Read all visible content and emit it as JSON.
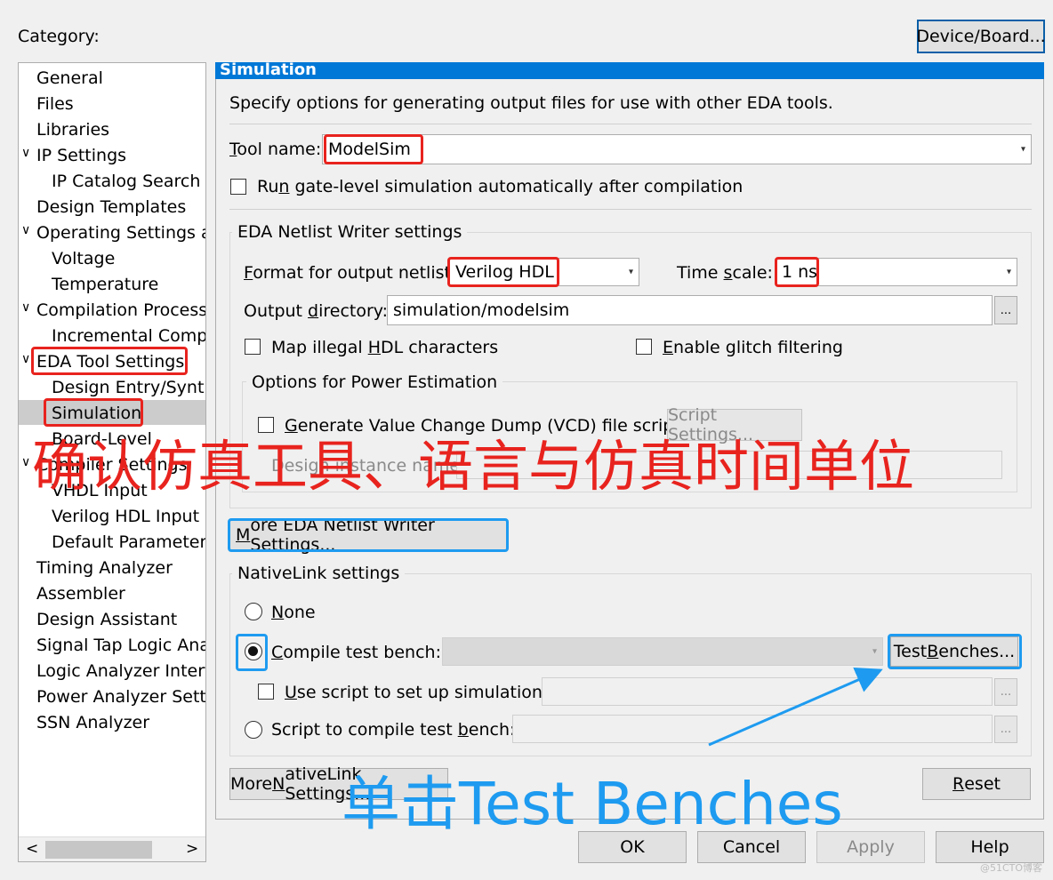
{
  "category_label": "Category:",
  "device_board_button": "Device/Board...",
  "tree": {
    "general": "General",
    "files": "Files",
    "libraries": "Libraries",
    "ip_settings": "IP Settings",
    "ip_catalog": "IP Catalog Search L",
    "design_templates": "Design Templates",
    "operating_settings": "Operating Settings ar",
    "voltage": "Voltage",
    "temperature": "Temperature",
    "compilation_process": "Compilation Process",
    "incremental": "Incremental Compil",
    "eda_tool_settings": "EDA Tool Settings",
    "design_entry": "Design Entry/Synth",
    "simulation": "Simulation",
    "board_level": "Board-Level",
    "compiler_settings": "Compiler Settings",
    "vhdl_input": "VHDL Input",
    "verilog_input": "Verilog HDL Input",
    "default_parameters": "Default Parameters",
    "timing_analyzer": "Timing Analyzer",
    "assembler": "Assembler",
    "design_assistant": "Design Assistant",
    "signal_tap": "Signal Tap Logic Anal",
    "logic_analyzer": "Logic Analyzer Interfa",
    "power_analyzer": "Power Analyzer Setti",
    "ssn_analyzer": "SSN Analyzer",
    "scroll_left": "<",
    "scroll_right": ">"
  },
  "panel": {
    "title": "Simulation",
    "description": "Specify options for generating output files for use with other EDA tools.",
    "tool_name_label_u": "T",
    "tool_name_label_rest": "ool name:",
    "tool_name_value": "ModelSim",
    "run_gate_label_a": "Ru",
    "run_gate_label_u": "n",
    "run_gate_label_b": " gate-level simulation automatically after compilation",
    "netlist_group": "EDA Netlist Writer settings",
    "format_label_u": "F",
    "format_label_rest": "ormat for output netlist:",
    "format_value": "Verilog HDL",
    "timescale_label_a": "Time ",
    "timescale_label_u": "s",
    "timescale_label_b": "cale:",
    "timescale_value": "1 ns",
    "outdir_label_a": "Output ",
    "outdir_label_u": "d",
    "outdir_label_b": "irectory:",
    "outdir_value": "simulation/modelsim",
    "browse": "...",
    "map_illegal_a": "Map illegal ",
    "map_illegal_u": "H",
    "map_illegal_b": "DL characters",
    "glitch_u": "E",
    "glitch_rest": "nable glitch filtering",
    "power_group": "Options for Power Estimation",
    "vcd_u": "G",
    "vcd_rest": "enerate Value Change Dump (VCD) file script",
    "script_settings": "Script Settings...",
    "design_instance_label": "Design instance name:",
    "more_eda_u": "M",
    "more_eda_rest": "ore EDA Netlist Writer Settings...",
    "nativelink_group": "NativeLink settings",
    "none_a": "N",
    "none_b": "one",
    "compile_tb_u": "C",
    "compile_tb_rest": "ompile test bench:",
    "test_benches_a": "Test ",
    "test_benches_u": "B",
    "test_benches_b": "enches...",
    "use_script_u": "U",
    "use_script_rest": "se script to set up simulation:",
    "script_compile_a": "Script to compile test ",
    "script_compile_u": "b",
    "script_compile_b": "ench:",
    "more_nativelink_a": "More ",
    "more_nativelink_u": "N",
    "more_nativelink_b": "ativeLink Settings...",
    "reset_u": "R",
    "reset_rest": "eset"
  },
  "footer": {
    "ok": "OK",
    "cancel": "Cancel",
    "apply": "Apply",
    "help": "Help"
  },
  "annotations": {
    "red_caption": "确认仿真工具、语言与仿真时间单位",
    "blue_caption": "单击Test Benches",
    "watermark": "@51CTO博客"
  },
  "colors": {
    "title_bar": "#0078d7",
    "red_annotation": "#e8231e",
    "blue_annotation": "#1e9bf0",
    "tree_selection": "#cccccc"
  }
}
